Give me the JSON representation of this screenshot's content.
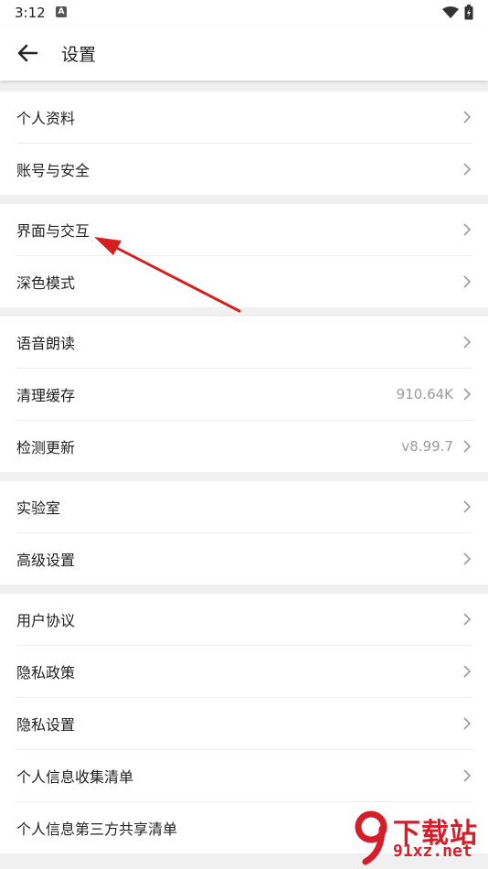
{
  "status_bar": {
    "time": "3:12",
    "notification_icon": "A"
  },
  "header": {
    "title": "设置"
  },
  "groups": [
    {
      "items": [
        {
          "label": "个人资料",
          "value": ""
        },
        {
          "label": "账号与安全",
          "value": ""
        }
      ]
    },
    {
      "items": [
        {
          "label": "界面与交互",
          "value": ""
        },
        {
          "label": "深色模式",
          "value": ""
        }
      ]
    },
    {
      "items": [
        {
          "label": "语音朗读",
          "value": ""
        },
        {
          "label": "清理缓存",
          "value": "910.64K"
        },
        {
          "label": "检测更新",
          "value": "v8.99.7"
        }
      ]
    },
    {
      "items": [
        {
          "label": "实验室",
          "value": ""
        },
        {
          "label": "高级设置",
          "value": ""
        }
      ]
    },
    {
      "items": [
        {
          "label": "用户协议",
          "value": ""
        },
        {
          "label": "隐私政策",
          "value": ""
        },
        {
          "label": "隐私设置",
          "value": ""
        },
        {
          "label": "个人信息收集清单",
          "value": ""
        },
        {
          "label": "个人信息第三方共享清单",
          "value": ""
        }
      ]
    }
  ],
  "watermark": {
    "logo_text": "下载站",
    "url": "91xz.net"
  },
  "colors": {
    "background": "#f0f0f0",
    "card": "#ffffff",
    "annotation_arrow": "#d61e1e",
    "watermark": "#d61e2b"
  }
}
